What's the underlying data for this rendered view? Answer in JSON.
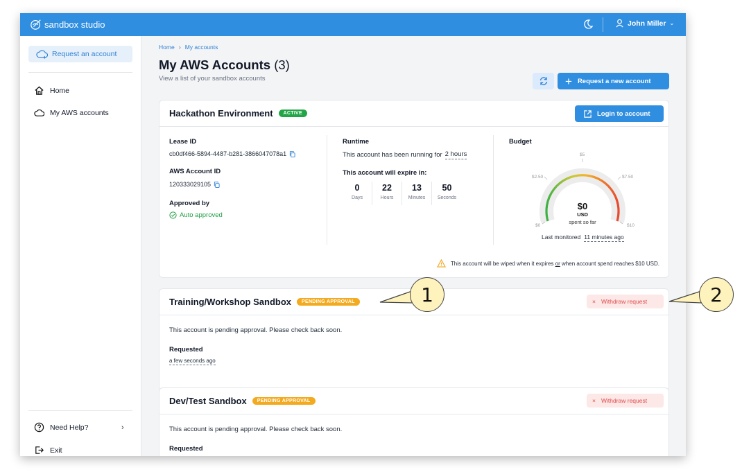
{
  "app": {
    "brand": "sandbox studio",
    "user_name": "John Miller",
    "accent": "#2f8ee0"
  },
  "sidebar": {
    "request_label": "Request an account",
    "items": [
      {
        "label": "Home",
        "icon": "home-icon"
      },
      {
        "label": "My AWS accounts",
        "icon": "cloud-icon"
      }
    ],
    "help_label": "Need Help?",
    "exit_label": "Exit"
  },
  "page": {
    "breadcrumb": [
      "Home",
      "My accounts"
    ],
    "title": "My AWS Accounts",
    "count": "(3)",
    "subtitle": "View a list of your sandbox accounts",
    "new_account_label": "Request a new account"
  },
  "accounts": [
    {
      "name": "Hackathon Environment",
      "status": "ACTIVE",
      "login_label": "Login to account",
      "lease_id_label": "Lease ID",
      "lease_id": "cb0df466-5894-4487-b281-3866047078a1",
      "aws_id_label": "AWS Account ID",
      "aws_id": "120333029105",
      "approved_label": "Approved by",
      "approved_value": "Auto approved",
      "runtime_label": "Runtime",
      "running_text": "This account has been running for",
      "running_value": "2 hours",
      "expire_label": "This account will expire in:",
      "timer": [
        {
          "n": "0",
          "u": "Days"
        },
        {
          "n": "22",
          "u": "Hours"
        },
        {
          "n": "13",
          "u": "Minutes"
        },
        {
          "n": "50",
          "u": "Seconds"
        }
      ],
      "budget_label": "Budget",
      "budget": {
        "amount": "$0",
        "currency": "USD",
        "note": "spent so far",
        "ticks": [
          "$0",
          "$2.50",
          "$5",
          "$7.50",
          "$10"
        ],
        "spent_fraction": 0,
        "last_monitored_label": "Last monitored",
        "last_monitored": "11 minutes ago"
      },
      "warning_pre": "This account will be wiped when it expires",
      "warning_or": "or",
      "warning_post": "when account spend reaches $10 USD."
    },
    {
      "name": "Training/Workshop Sandbox",
      "status": "PENDING APPROVAL",
      "withdraw_label": "Withdraw request",
      "pending_text": "This account is pending approval. Please check back soon.",
      "requested_label": "Requested",
      "requested_value": "a few seconds ago"
    },
    {
      "name": "Dev/Test Sandbox",
      "status": "PENDING APPROVAL",
      "withdraw_label": "Withdraw request",
      "pending_text": "This account is pending approval. Please check back soon.",
      "requested_label": "Requested"
    }
  ],
  "callouts": [
    "1",
    "2"
  ]
}
